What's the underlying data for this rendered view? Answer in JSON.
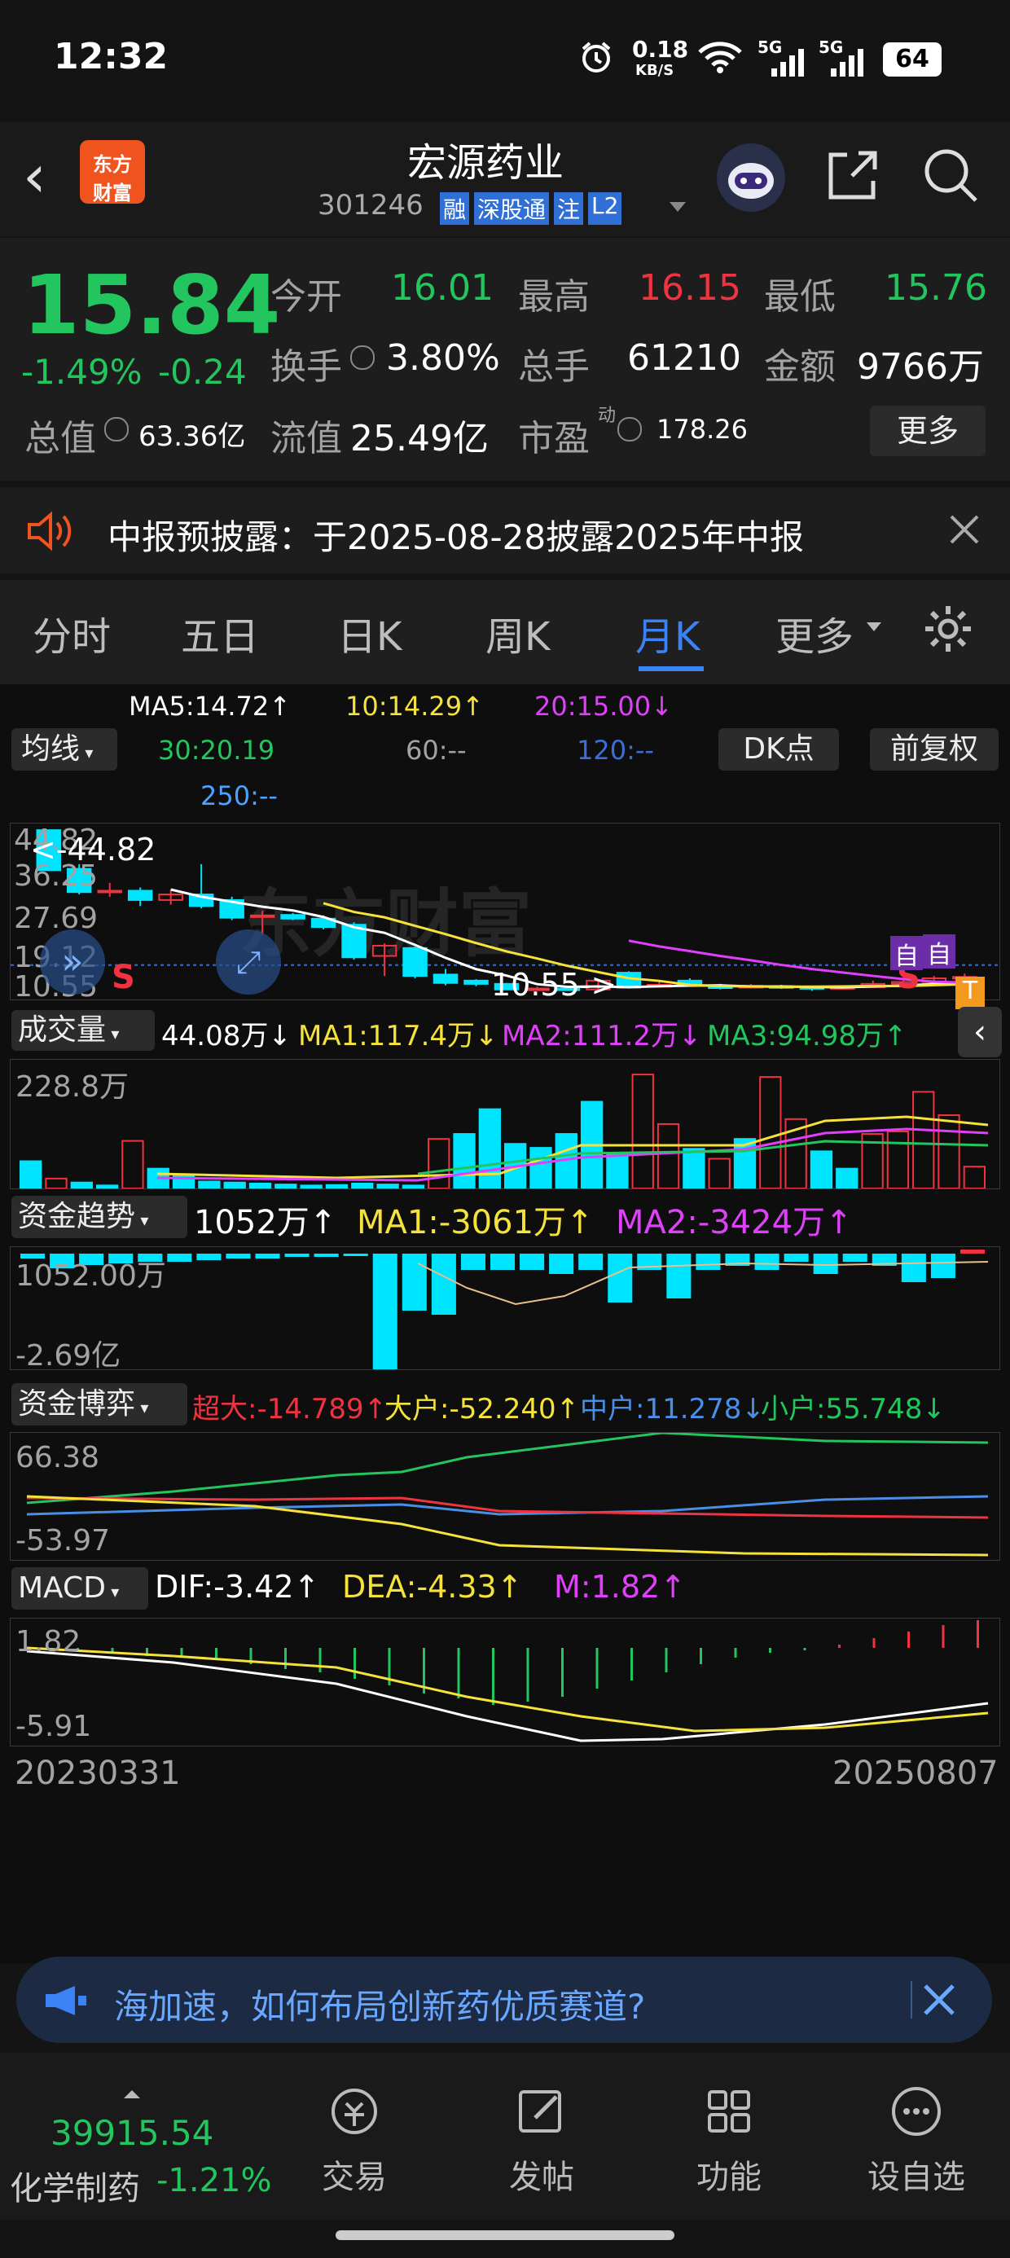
{
  "status": {
    "time": "12:32",
    "net_speed": "0.18",
    "net_unit": "KB/S",
    "battery": "64",
    "sig1": "5G",
    "sig2": "5G"
  },
  "header": {
    "back": "‹",
    "logo_line1": "东方",
    "logo_line2": "财富",
    "stock_name": "宏源药业",
    "code": "301246",
    "badges": [
      "融",
      "深股通",
      "注",
      "L2"
    ],
    "ai_icon": "robot",
    "share_icon": "share",
    "search_icon": "search"
  },
  "quote": {
    "price": "15.84",
    "pct": "-1.49%",
    "chg": "-0.24",
    "open_label": "今开",
    "open": "16.01",
    "high_label": "最高",
    "high": "16.15",
    "low_label": "最低",
    "low": "15.76",
    "turnover_label": "换手",
    "turnover": "3.80%",
    "vol_label": "总手",
    "vol": "61210",
    "amount_label": "金额",
    "amount": "9766万",
    "mcap_label": "总值",
    "mcap": "63.36亿",
    "float_label": "流值",
    "float": "25.49亿",
    "pe_label": "市盈",
    "pe_sup": "动",
    "pe": "178.26",
    "more": "更多"
  },
  "notice": {
    "text": "中报预披露：于2025-08-28披露2025年中报"
  },
  "tabs": [
    "分时",
    "五日",
    "日K",
    "周K",
    "月K",
    "更多"
  ],
  "ma": {
    "ma5": "MA5:14.72↑",
    "ma10": "10:14.29↑",
    "ma20": "20:15.00↓",
    "ma30": "30:20.19",
    "ma60": "60:--",
    "ma120": "120:--",
    "ma250": "250:--",
    "selector": "均线",
    "dk": "DK点",
    "adj": "前复权"
  },
  "kchart": {
    "y_labels": [
      "44.82",
      "36.25",
      "27.69",
      "19.12",
      "10.55"
    ],
    "high_label": "<-44.82",
    "low_label": "10.55->",
    "watermark": "东方财富",
    "s_marks": [
      "S",
      "S"
    ],
    "self_marks": [
      "自",
      "自"
    ],
    "t_mark": "T"
  },
  "volume": {
    "selector": "成交量",
    "v": "44.08万↓",
    "ma1": "MA1:117.4万↓",
    "ma2": "MA2:111.2万↓",
    "ma3": "MA3:94.98万↑",
    "ymax": "228.8万"
  },
  "fund": {
    "selector": "资金趋势",
    "v": "1052万↑",
    "ma1": "MA1:-3061万↑",
    "ma2": "MA2:-3424万↑",
    "y_top": "1052.00万",
    "y_bot": "-2.69亿"
  },
  "game": {
    "selector": "资金博弈",
    "super": "超大:-14.789↑",
    "big": "大户:-52.240↑",
    "mid": "中户:11.278↓",
    "small": "小户:55.748↓",
    "y_top": "66.38",
    "y_bot": "-53.97"
  },
  "macd": {
    "selector": "MACD",
    "dif": "DIF:-3.42↑",
    "dea": "DEA:-4.33↑",
    "m": "M:1.82↑",
    "y_top": "1.82",
    "y_bot": "-5.91",
    "date_start": "20230331",
    "date_end": "20250807"
  },
  "banner": {
    "text": "海加速，如何布局创新药优质赛道?"
  },
  "bottom": {
    "index": "39915.54",
    "sector": "化学制药",
    "sector_pct": "-1.21%",
    "items": [
      "交易",
      "发帖",
      "功能",
      "设自选"
    ]
  },
  "chart_data": {
    "type": "candlestick",
    "candles": [
      {
        "o": 44.8,
        "c": 36.2,
        "h": 44.8,
        "l": 36.0
      },
      {
        "o": 36.5,
        "c": 31.5,
        "h": 37.5,
        "l": 31.0
      },
      {
        "o": 31.5,
        "c": 31.8,
        "h": 33.5,
        "l": 30.5
      },
      {
        "o": 31.8,
        "c": 29.8,
        "h": 32.5,
        "l": 28.5
      },
      {
        "o": 29.8,
        "c": 31.0,
        "h": 32.0,
        "l": 28.8
      },
      {
        "o": 31.0,
        "c": 28.5,
        "h": 37.5,
        "l": 28.0
      },
      {
        "o": 29.8,
        "c": 26.0,
        "h": 30.5,
        "l": 25.5
      },
      {
        "o": 26.5,
        "c": 26.5,
        "h": 27.5,
        "l": 22.5
      },
      {
        "o": 26.6,
        "c": 25.8,
        "h": 27.0,
        "l": 25.5
      },
      {
        "o": 25.8,
        "c": 24.0,
        "h": 26.5,
        "l": 23.5
      },
      {
        "o": 24.5,
        "c": 17.5,
        "h": 25.0,
        "l": 17.0
      },
      {
        "o": 17.8,
        "c": 20.0,
        "h": 20.5,
        "l": 13.5
      },
      {
        "o": 19.5,
        "c": 13.5,
        "h": 19.8,
        "l": 13.0
      },
      {
        "o": 13.8,
        "c": 12.0,
        "h": 15.0,
        "l": 11.5
      },
      {
        "o": 12.5,
        "c": 11.8,
        "h": 12.8,
        "l": 11.3
      },
      {
        "o": 11.8,
        "c": 10.6,
        "h": 12.0,
        "l": 10.55
      },
      {
        "o": 10.8,
        "c": 10.8,
        "h": 11.2,
        "l": 10.6
      },
      {
        "o": 10.8,
        "c": 10.6,
        "h": 11.2,
        "l": 10.55
      },
      {
        "o": 10.6,
        "c": 12.5,
        "h": 12.8,
        "l": 10.55
      },
      {
        "o": 14.2,
        "c": 11.0,
        "h": 14.5,
        "l": 10.8
      },
      {
        "o": 11.2,
        "c": 11.6,
        "h": 12.2,
        "l": 11.0
      },
      {
        "o": 12.5,
        "c": 11.4,
        "h": 13.0,
        "l": 11.2
      },
      {
        "o": 11.4,
        "c": 10.9,
        "h": 11.8,
        "l": 10.6
      },
      {
        "o": 11.0,
        "c": 11.4,
        "h": 11.8,
        "l": 10.8
      },
      {
        "o": 11.3,
        "c": 11.0,
        "h": 11.6,
        "l": 10.7
      },
      {
        "o": 11.1,
        "c": 10.9,
        "h": 11.4,
        "l": 10.3
      },
      {
        "o": 10.9,
        "c": 11.1,
        "h": 11.5,
        "l": 10.7
      },
      {
        "o": 11.1,
        "c": 11.8,
        "h": 12.5,
        "l": 10.9
      },
      {
        "o": 11.8,
        "c": 12.2,
        "h": 13.5,
        "l": 11.5
      },
      {
        "o": 12.2,
        "c": 13.0,
        "h": 13.5,
        "l": 11.8
      },
      {
        "o": 13.0,
        "c": 13.3,
        "h": 14.0,
        "l": 12.6
      }
    ],
    "ymin": 10.55,
    "ymax": 44.82,
    "volumes": [
      55,
      22,
      12,
      5,
      100,
      38,
      28,
      18,
      15,
      12,
      10,
      8,
      7,
      0,
      0,
      0,
      0,
      0,
      0,
      0,
      0,
      0,
      0,
      0,
      0,
      0,
      0,
      0,
      0,
      0,
      0
    ],
    "volumes_tail": [
      110,
      120,
      160,
      90,
      85,
      120,
      175,
      75,
      230,
      130,
      95,
      70,
      95,
      230,
      140,
      80,
      40,
      115,
      115,
      195,
      150,
      44
    ],
    "vol_ymax": 228.8
  }
}
